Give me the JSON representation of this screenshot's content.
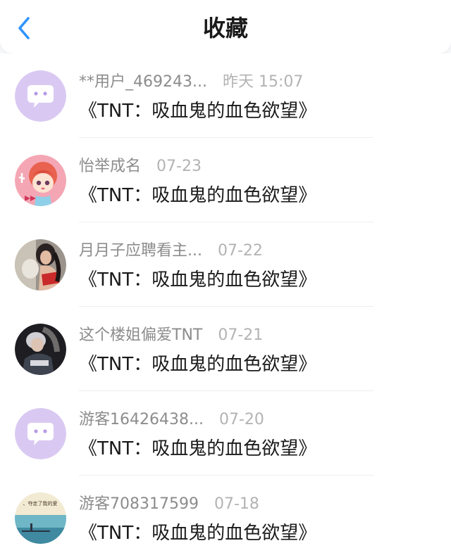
{
  "header": {
    "title": "收藏",
    "back_icon": "chevron-left-icon",
    "accent_color": "#2f95ff"
  },
  "favorites": [
    {
      "username": "**用户_469243...",
      "time": "昨天 15:07",
      "work": "《TNT：吸血鬼的血色欲望》",
      "avatar": "default-chat-avatar"
    },
    {
      "username": "怡举成名",
      "time": "07-23",
      "work": "《TNT：吸血鬼的血色欲望》",
      "avatar": "cartoon-girl-avatar"
    },
    {
      "username": "月月子应聘看主...",
      "time": "07-22",
      "work": "《TNT：吸血鬼的血色欲望》",
      "avatar": "photo-woman-avatar"
    },
    {
      "username": "这个楼姐偏爱TNT",
      "time": "07-21",
      "work": "《TNT：吸血鬼的血色欲望》",
      "avatar": "photo-dark-avatar"
    },
    {
      "username": "游客16426438...",
      "time": "07-20",
      "work": "《TNT：吸血鬼的血色欲望》",
      "avatar": "default-chat-avatar"
    },
    {
      "username": "游客708317599",
      "time": "07-18",
      "work": "《TNT：吸血鬼的血色欲望》",
      "avatar": "seaside-avatar",
      "avatar_text": "、夺走了我的爱"
    }
  ]
}
